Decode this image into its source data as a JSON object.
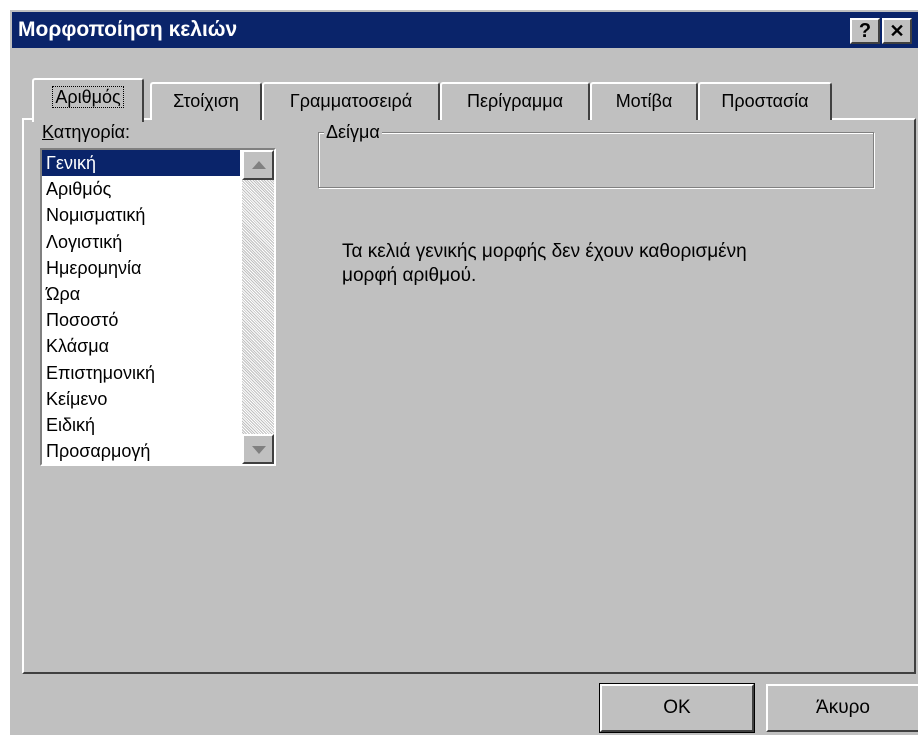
{
  "window": {
    "title": "Μορφοποίηση κελιών",
    "help_label": "?",
    "close_label": "✕"
  },
  "tabs": [
    {
      "label": "Αριθμός",
      "active": true
    },
    {
      "label": "Στοίχιση"
    },
    {
      "label": "Γραμματοσειρά"
    },
    {
      "label": "Περίγραμμα"
    },
    {
      "label": "Μοτίβα"
    },
    {
      "label": "Προστασία"
    }
  ],
  "category": {
    "label_hotkey": "Κ",
    "label_rest": "ατηγορία:",
    "items": [
      {
        "label": "Γενική",
        "selected": true
      },
      {
        "label": "Αριθμός"
      },
      {
        "label": "Νομισματική"
      },
      {
        "label": "Λογιστική"
      },
      {
        "label": "Ημερομηνία"
      },
      {
        "label": "Ώρα"
      },
      {
        "label": "Ποσοστό"
      },
      {
        "label": "Κλάσμα"
      },
      {
        "label": "Επιστημονική"
      },
      {
        "label": "Κείμενο"
      },
      {
        "label": "Ειδική"
      },
      {
        "label": "Προσαρμογή"
      }
    ]
  },
  "sample": {
    "label": "Δείγμα",
    "value": ""
  },
  "description": "Τα κελιά γενικής μορφής δεν έχουν καθορισμένη μορφή αριθμού.",
  "buttons": {
    "ok_label": "OK",
    "cancel_label": "Άκυρο"
  },
  "colors": {
    "face": "#c0c0c0",
    "titlebar": "#0a246a",
    "selection": "#0a246a"
  }
}
